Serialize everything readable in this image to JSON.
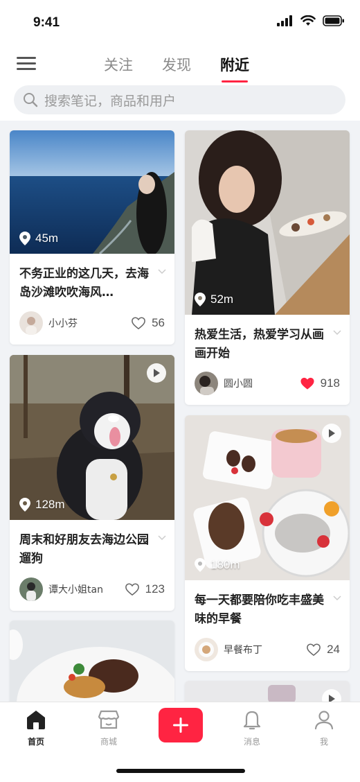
{
  "status": {
    "time": "9:41"
  },
  "nav": {
    "tabs": [
      "关注",
      "发现",
      "附近"
    ],
    "active_tab": "附近"
  },
  "search": {
    "placeholder": "搜索笔记，商品和用户"
  },
  "feed": {
    "left": [
      {
        "distance": "45m",
        "title": "不务正业的这几天，去海岛沙滩吹吹海风…",
        "author": "小小芬",
        "likes": "56",
        "liked": false,
        "video": false
      },
      {
        "distance": "128m",
        "title": "周末和好朋友去海边公园遛狗",
        "author": "谭大小姐tan",
        "likes": "123",
        "liked": false,
        "video": true
      },
      {
        "distance": "",
        "title": "",
        "author": "",
        "likes": "",
        "liked": false,
        "video": false
      }
    ],
    "right": [
      {
        "distance": "52m",
        "title": "热爱生活，热爱学习从画画开始",
        "author": "圆小圆",
        "likes": "918",
        "liked": true,
        "video": false
      },
      {
        "distance": "180m",
        "title": "每一天都要陪你吃丰盛美味的早餐",
        "author": "早餐布丁",
        "likes": "24",
        "liked": false,
        "video": true
      },
      {
        "distance": "",
        "title": "",
        "author": "",
        "likes": "",
        "liked": false,
        "video": true
      }
    ]
  },
  "bottom_nav": {
    "home": "首页",
    "mall": "商城",
    "messages": "消息",
    "me": "我"
  },
  "colors": {
    "accent": "#ff2442",
    "background": "#f1f3f6"
  }
}
